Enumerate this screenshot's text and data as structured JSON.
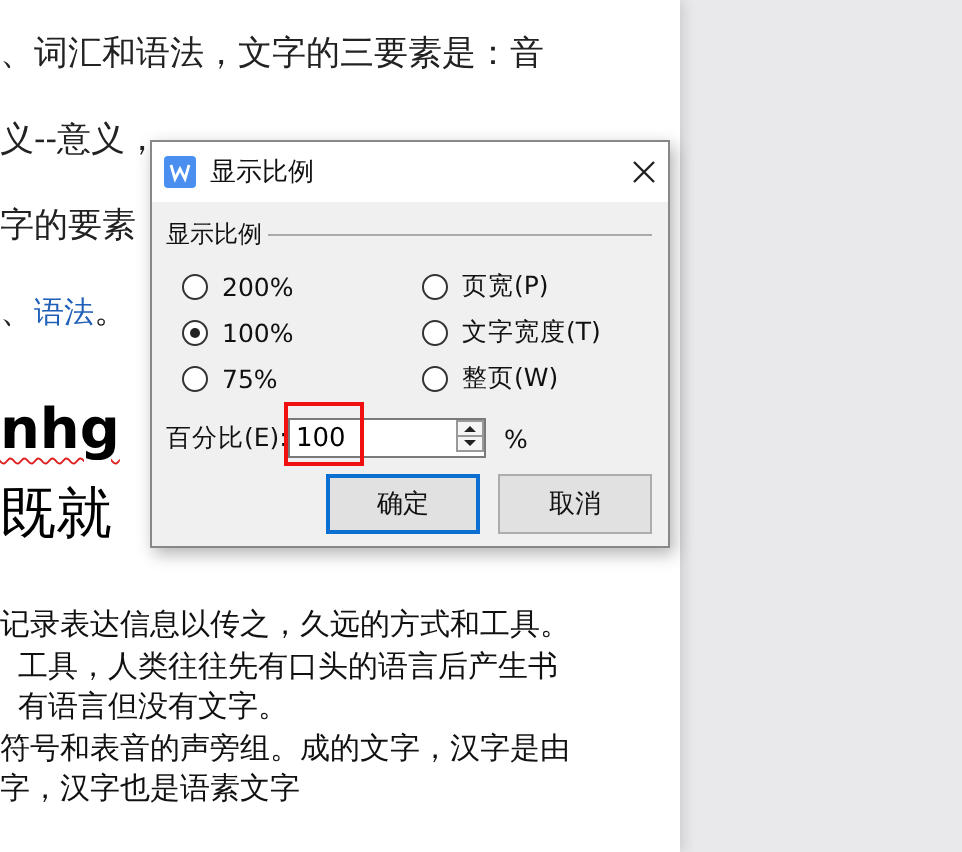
{
  "document": {
    "lines": [
      {
        "kind": "text",
        "text": "、词汇和语法，文字的三要素是：音"
      },
      {
        "kind": "text",
        "text": "义--意义，"
      },
      {
        "kind": "text",
        "text": "字的要素"
      },
      {
        "kind": "link_line",
        "before": "、",
        "link": "语法",
        "after": "。"
      },
      {
        "kind": "heading",
        "text": "nhg",
        "misspelled": true
      },
      {
        "kind": "heading_cn",
        "text": "既就"
      },
      {
        "kind": "small",
        "text": "记录表达信息以传之，久远的方式和工具。"
      },
      {
        "kind": "small_indent",
        "text": "工具，人类往往先有口头的语言后产生书"
      },
      {
        "kind": "small_indent",
        "text": "有语言但没有文字。"
      },
      {
        "kind": "small",
        "text": "符号和表音的声旁组。成的文字，汉字是由"
      },
      {
        "kind": "small",
        "text": "字，汉字也是语素文字"
      }
    ]
  },
  "dialog": {
    "title": "显示比例",
    "group_label": "显示比例",
    "options": [
      {
        "label": "200%",
        "selected": false
      },
      {
        "label": "页宽(P)",
        "selected": false
      },
      {
        "label": "100%",
        "selected": true
      },
      {
        "label": "文字宽度(T)",
        "selected": false
      },
      {
        "label": "75%",
        "selected": false
      },
      {
        "label": "整页(W)",
        "selected": false
      }
    ],
    "percent_label": "百分比(E):",
    "percent_value": "100",
    "percent_unit": "%",
    "highlighted": true,
    "buttons": [
      {
        "label": "确定",
        "default": true
      },
      {
        "label": "取消",
        "default": false
      }
    ]
  }
}
